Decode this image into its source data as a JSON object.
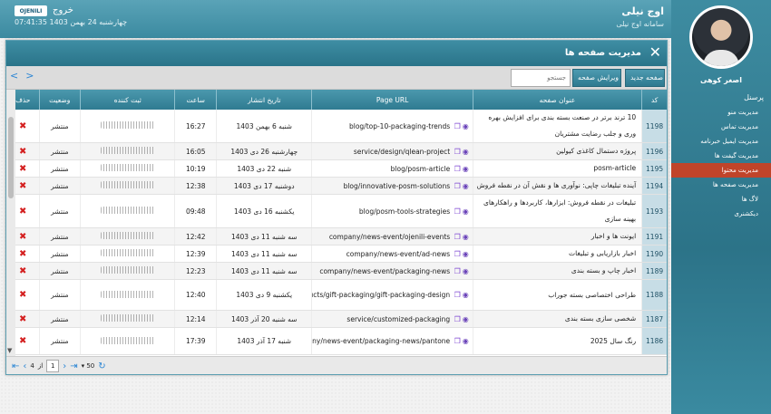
{
  "header": {
    "brand_title": "اوج نیلی",
    "brand_sub": "سامانه اوج نیلی",
    "logout": "خروج",
    "datetime": "چهارشنبه 24 بهمن 1403  07:41:35",
    "logo_text": "OJENILI"
  },
  "user": {
    "name": "اصغر کوهی"
  },
  "sidebar": {
    "items": [
      {
        "label": "پرسنل"
      },
      {
        "label": "مدیریت منو"
      },
      {
        "label": "مدیریت تماس"
      },
      {
        "label": "مدیریت ایمیل خبرنامه"
      },
      {
        "label": "مدیریت گیفت ها"
      },
      {
        "label": "مدیریت محتوا"
      },
      {
        "label": "مدیریت صفحه ها"
      },
      {
        "label": "لاگ ها"
      },
      {
        "label": "دیکشنری"
      }
    ]
  },
  "panel": {
    "title": "مدیریت صفحه ها"
  },
  "toolbar": {
    "new_label": "صفحه جدید",
    "edit_label": "ویرایش صفحه",
    "search_placeholder": "جستجو"
  },
  "table": {
    "headers": [
      "کد",
      "عنوان صفحه",
      "Page URL",
      "تاریخ انتشار",
      "ساعت",
      "ثبت کننده",
      "وضعیت",
      "حذف"
    ],
    "rows": [
      {
        "code": "1198",
        "title": "10 ترند برتر در صنعت بسته بندی برای افزایش بهره وری و جلب رضایت مشتریان",
        "url": "blog/top-10-packaging-trends",
        "date": "شنبه 6 بهمن 1403",
        "time": "16:27",
        "status": "منتشر"
      },
      {
        "code": "1196",
        "title": "پروژه دستمال کاغذی کیولین",
        "url": "service/design/qlean-project",
        "date": "چهارشنبه 26 دی 1403",
        "time": "16:05",
        "status": "منتشر"
      },
      {
        "code": "1195",
        "title": "posm-article",
        "url": "blog/posm-article",
        "date": "شنبه 22 دی 1403",
        "time": "10:19",
        "status": "منتشر"
      },
      {
        "code": "1194",
        "title": "آینده تبلیغات چاپی: نوآوری ها و نقش آن در نقطه فروش",
        "url": "blog/innovative-posm-solutions",
        "date": "دوشنبه 17 دی 1403",
        "time": "12:38",
        "status": "منتشر"
      },
      {
        "code": "1193",
        "title": "تبلیغات در نقطه فروش: ابزارها، کاربردها و راهکارهای بهینه سازی",
        "url": "blog/posm-tools-strategies",
        "date": "یکشنبه 16 دی 1403",
        "time": "09:48",
        "status": "منتشر"
      },
      {
        "code": "1191",
        "title": "ایونت ها و اخبار",
        "url": "company/news-event/ojenili-events",
        "date": "سه شنبه 11 دی 1403",
        "time": "12:42",
        "status": "منتشر"
      },
      {
        "code": "1190",
        "title": "اخبار بازاریابی و تبلیغات",
        "url": "company/news-event/ad-news",
        "date": "سه شنبه 11 دی 1403",
        "time": "12:39",
        "status": "منتشر"
      },
      {
        "code": "1189",
        "title": "اخبار چاپ و بسته بندی",
        "url": "company/news-event/packaging-news",
        "date": "سه شنبه 11 دی 1403",
        "time": "12:23",
        "status": "منتشر"
      },
      {
        "code": "1188",
        "title": "طراحی اختصاصی بسته جوراب",
        "url": "products/gift-packaging/gift-packaging-design",
        "date": "یکشنبه 9 دی 1403",
        "time": "12:40",
        "status": "منتشر"
      },
      {
        "code": "1187",
        "title": "شخصی سازی بسته بندی",
        "url": "service/customized-packaging",
        "date": "سه شنبه 20 آذر 1403",
        "time": "12:14",
        "status": "منتشر"
      },
      {
        "code": "1186",
        "title": "رنگ سال 2025",
        "url": "company/news-event/packaging-news/pantone-",
        "date": "شنبه 17 آذر 1403",
        "time": "17:39",
        "status": "منتشر"
      }
    ]
  },
  "pager": {
    "current_page": "1",
    "of_label": "از",
    "total_pages": "4",
    "page_size": "50"
  }
}
